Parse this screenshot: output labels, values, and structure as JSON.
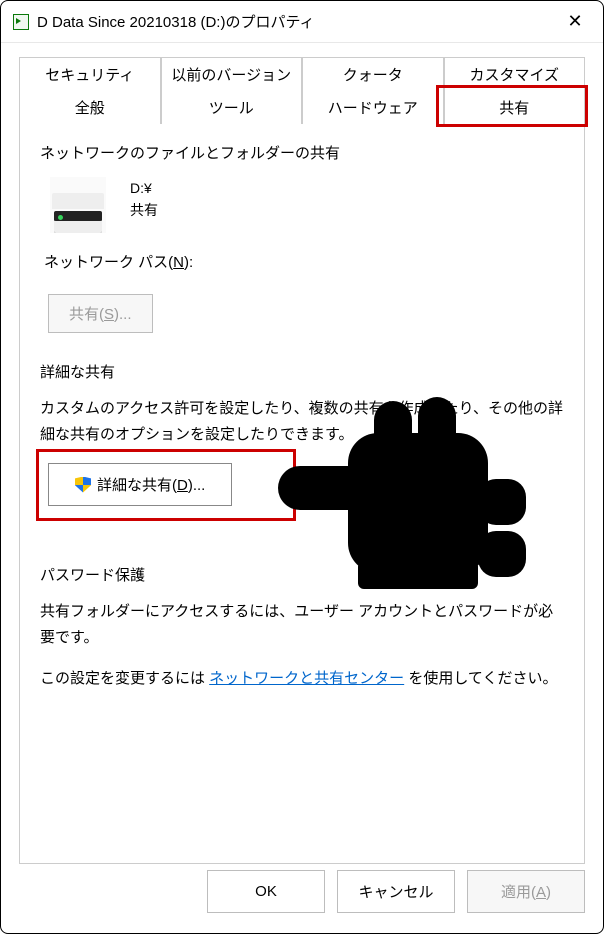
{
  "window": {
    "title": "D Data Since 20210318 (D:)のプロパティ"
  },
  "tabs": {
    "top": [
      "セキュリティ",
      "以前のバージョン",
      "クォータ",
      "カスタマイズ"
    ],
    "bottom": [
      "全般",
      "ツール",
      "ハードウェア",
      "共有"
    ],
    "active": "共有"
  },
  "network_share": {
    "group_title": "ネットワークのファイルとフォルダーの共有",
    "drive_path": "D:¥",
    "share_status": "共有",
    "network_path_label_pre": "ネットワーク パス(",
    "network_path_label_key": "N",
    "network_path_label_post": "):",
    "share_button_pre": "共有(",
    "share_button_key": "S",
    "share_button_post": ")..."
  },
  "advanced_share": {
    "group_title": "詳細な共有",
    "desc": "カスタムのアクセス許可を設定したり、複数の共有を作成したり、その他の詳細な共有のオプションを設定したりできます。",
    "button_pre": "詳細な共有(",
    "button_key": "D",
    "button_post": ")..."
  },
  "password": {
    "group_title": "パスワード保護",
    "line1": "共有フォルダーにアクセスするには、ユーザー アカウントとパスワードが必要です。",
    "line2_pre": "この設定を変更するには ",
    "link": "ネットワークと共有センター",
    "line2_post": " を使用してください。"
  },
  "footer": {
    "ok": "OK",
    "cancel": "キャンセル",
    "apply_pre": "適用(",
    "apply_key": "A",
    "apply_post": ")"
  }
}
